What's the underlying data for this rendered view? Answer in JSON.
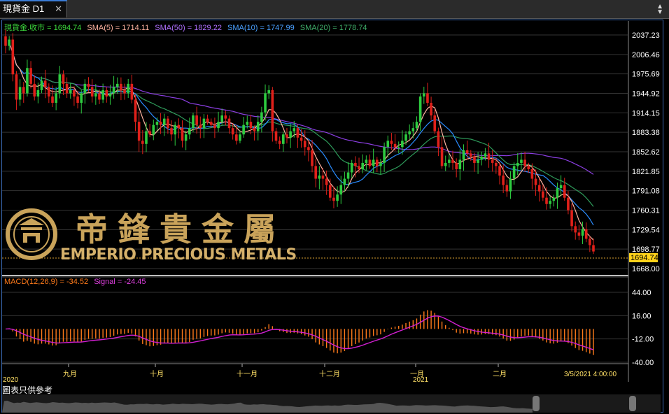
{
  "tab": {
    "title": "現貨金 D1"
  },
  "legend": {
    "close_label": "現貨金.收市 = 1694.74",
    "sma5_label": "SMA(5) = 1714.11",
    "sma50_label": "SMA(50) = 1829.22",
    "sma10_label": "SMA(10) = 1747.99",
    "sma20_label": "SMA(20) = 1778.74"
  },
  "macd_legend": {
    "macd_label": "MACD(12,26,9) = -34.52",
    "signal_label": "Signal = -24.45"
  },
  "last_price": "1694.74",
  "logo": {
    "chinese": "帝鋒貴金屬",
    "english": "EMPERIO PRECIOUS METALS"
  },
  "footnote": "圖表只供參考",
  "colors": {
    "up": "#2ecc40",
    "down": "#e0201a",
    "sma5": "#ffb3a0",
    "sma10": "#2a8cff",
    "sma20": "#2e9a5a",
    "sma50": "#8a3ee0",
    "macd": "#ff7a1a",
    "signal": "#d21fd2",
    "axis_text": "#ffffff",
    "legend_green": "#3ddc3d"
  },
  "chart_data": {
    "type": "candlestick",
    "instrument": "現貨金",
    "timeframe": "D1",
    "price_axis": {
      "ticks": [
        "2037.23",
        "2006.46",
        "1975.69",
        "1944.92",
        "1914.15",
        "1883.38",
        "1852.62",
        "1821.85",
        "1791.08",
        "1760.31",
        "1729.54",
        "1698.77",
        "1668.00"
      ],
      "range": [
        1668.0,
        2037.23
      ]
    },
    "macd_axis": {
      "ticks": [
        "44.00",
        "16.00",
        "-12.00",
        "-40.00"
      ],
      "range": [
        -40,
        44
      ]
    },
    "x_labels": [
      {
        "label": "2020",
        "sub": true
      },
      {
        "label": "九月"
      },
      {
        "label": "十月"
      },
      {
        "label": "十一月"
      },
      {
        "label": "十二月"
      },
      {
        "label": "一月"
      },
      {
        "label": "2021",
        "sub": true
      },
      {
        "label": "二月"
      },
      {
        "label": "3/5/2021 4:00:00"
      }
    ],
    "price_path": [
      2020,
      2030,
      1975,
      1935,
      1955,
      1945,
      1985,
      1960,
      1940,
      1950,
      1965,
      1955,
      1940,
      1930,
      1945,
      1975,
      1960,
      1945,
      1950,
      1940,
      1930,
      1945,
      1960,
      1955,
      1940,
      1945,
      1935,
      1950,
      1940,
      1945,
      1955,
      1960,
      1950,
      1945,
      1960,
      1935,
      1900,
      1870,
      1865,
      1885,
      1880,
      1895,
      1900,
      1895,
      1905,
      1890,
      1880,
      1895,
      1890,
      1870,
      1880,
      1890,
      1910,
      1895,
      1890,
      1905,
      1900,
      1895,
      1890,
      1900,
      1910,
      1905,
      1890,
      1880,
      1870,
      1880,
      1895,
      1900,
      1890,
      1885,
      1900,
      1915,
      1945,
      1950,
      1885,
      1870,
      1865,
      1880,
      1875,
      1885,
      1890,
      1875,
      1870,
      1860,
      1855,
      1830,
      1810,
      1815,
      1810,
      1800,
      1780,
      1775,
      1785,
      1800,
      1810,
      1820,
      1835,
      1830,
      1825,
      1835,
      1840,
      1830,
      1840,
      1830,
      1835,
      1860,
      1870,
      1865,
      1860,
      1860,
      1870,
      1880,
      1885,
      1890,
      1900,
      1940,
      1945,
      1930,
      1910,
      1885,
      1860,
      1830,
      1835,
      1840,
      1835,
      1825,
      1840,
      1855,
      1850,
      1845,
      1835,
      1840,
      1845,
      1850,
      1840,
      1835,
      1830,
      1815,
      1800,
      1790,
      1810,
      1830,
      1835,
      1840,
      1830,
      1825,
      1810,
      1800,
      1790,
      1780,
      1770,
      1775,
      1780,
      1795,
      1800,
      1780,
      1760,
      1735,
      1725,
      1720,
      1730,
      1715,
      1705,
      1695
    ]
  }
}
